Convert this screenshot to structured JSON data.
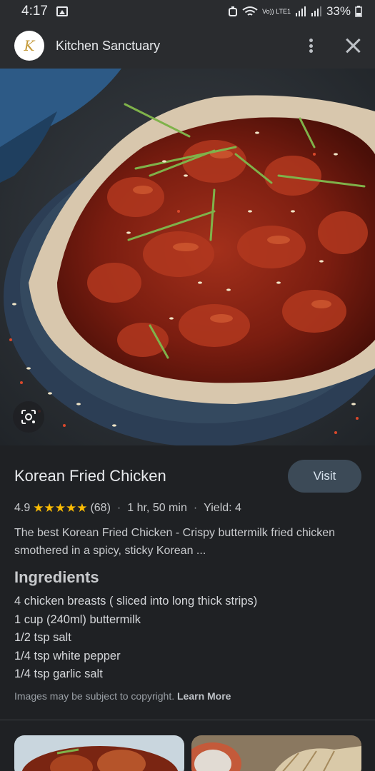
{
  "status_bar": {
    "time": "4:17",
    "network_label": "Vo)) LTE1",
    "battery": "33%"
  },
  "header": {
    "site_name": "Kitchen Sanctuary",
    "logo_text": "K"
  },
  "recipe": {
    "title": "Korean Fried Chicken",
    "visit_label": "Visit",
    "rating": "4.9",
    "stars": "★★★★★",
    "review_count": "(68)",
    "time": "1 hr, 50 min",
    "yield": "Yield: 4",
    "description": "The best Korean Fried Chicken - Crispy buttermilk fried chicken smothered in a spicy, sticky Korean ..."
  },
  "ingredients": {
    "heading": "Ingredients",
    "items": [
      "4 chicken breasts ( sliced into long thick strips)",
      "1 cup (240ml) buttermilk",
      "1/2 tsp salt",
      "1/4 tsp white pepper",
      "1/4 tsp garlic salt"
    ]
  },
  "footer": {
    "copyright_text": "Images may be subject to copyright.",
    "learn_more": "Learn More"
  },
  "icons": {
    "gallery": "gallery-icon",
    "more": "more-vert-icon",
    "close": "close-icon",
    "lens": "lens-icon"
  },
  "colors": {
    "background": "#1f2124",
    "header": "#2a2c2f",
    "visit_button": "#3c4a57",
    "stars": "#fbbc04"
  }
}
